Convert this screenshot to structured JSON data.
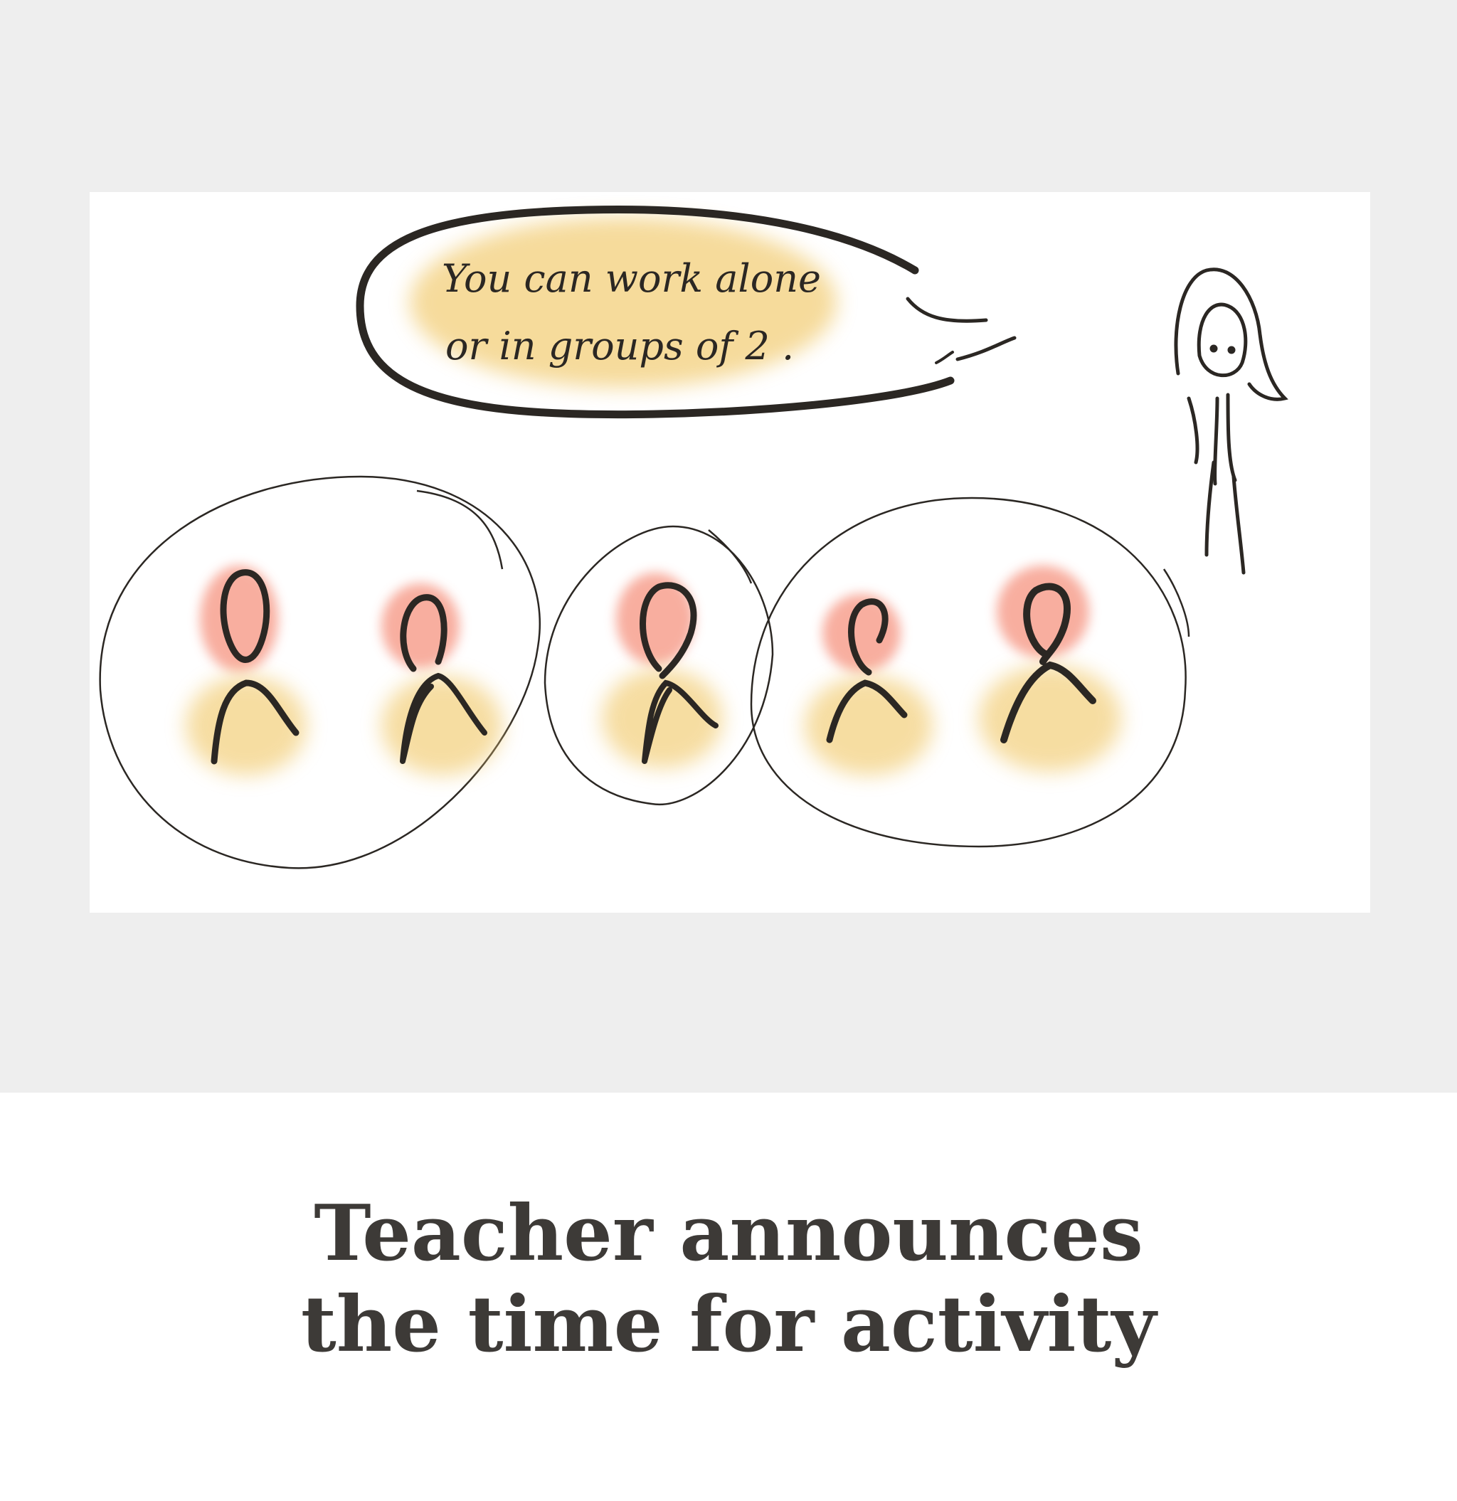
{
  "illustration": {
    "speech_bubble": {
      "line1": "You can work alone",
      "line2": "or in groups of 2 ."
    },
    "colors": {
      "head_wash": "#f7a08f",
      "body_wash": "#f3cf7a",
      "bubble_wash": "#f3cf7a",
      "ink": "#2b2723",
      "band_background": "#eeeeee",
      "caption_text": "#3d3a37"
    }
  },
  "caption": {
    "line1": "Teacher announces",
    "line2": "the time for activity"
  }
}
